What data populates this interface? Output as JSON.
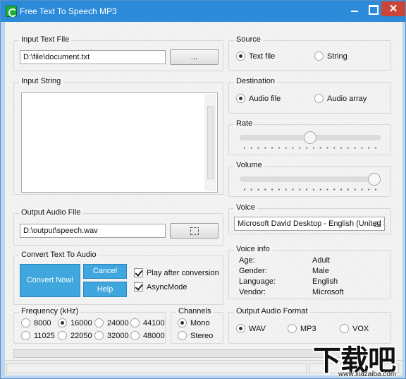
{
  "window": {
    "title": "Free Text To Speech MP3"
  },
  "input_text_file": {
    "title": "Input Text File",
    "path": "D:\\file\\document.txt",
    "browse_label": "..."
  },
  "input_string": {
    "title": "Input String",
    "value": ""
  },
  "output_audio_file": {
    "title": "Output Audio File",
    "path": "D:\\output\\speech.wav"
  },
  "convert": {
    "title": "Convert Text To Audio",
    "convert_label": "Convert Now!",
    "cancel_label": "Cancel",
    "help_label": "Help",
    "play_after_label": "Play after conversion",
    "play_after_checked": true,
    "async_label": "AsyncMode",
    "async_checked": true
  },
  "frequency": {
    "title": "Frequency (kHz)",
    "options": [
      "8000",
      "16000",
      "24000",
      "44100",
      "11025",
      "22050",
      "32000",
      "48000"
    ],
    "selected": "16000"
  },
  "channels": {
    "title": "Channels",
    "options": [
      "Mono",
      "Stereo"
    ],
    "selected": "Mono"
  },
  "source": {
    "title": "Source",
    "options": [
      "Text file",
      "String"
    ],
    "selected": "Text file"
  },
  "destination": {
    "title": "Destination",
    "options": [
      "Audio file",
      "Audio array"
    ],
    "selected": "Audio file"
  },
  "rate": {
    "title": "Rate",
    "level": 0.5
  },
  "volume": {
    "title": "Volume",
    "level": 1.0
  },
  "voice": {
    "title": "Voice",
    "selected": "Microsoft David Desktop - English (United States)"
  },
  "voice_info": {
    "title": "Voice info",
    "rows": [
      {
        "key": "Age:",
        "value": "Adult"
      },
      {
        "key": "Gender:",
        "value": "Male"
      },
      {
        "key": "Language:",
        "value": "English"
      },
      {
        "key": "Vendor:",
        "value": "Microsoft"
      }
    ]
  },
  "output_format": {
    "title": "Output Audio Format",
    "options": [
      "WAV",
      "MP3",
      "VOX"
    ],
    "selected": "WAV"
  },
  "watermark": {
    "text": "下载吧",
    "site": "www.xiazaiba.com"
  }
}
